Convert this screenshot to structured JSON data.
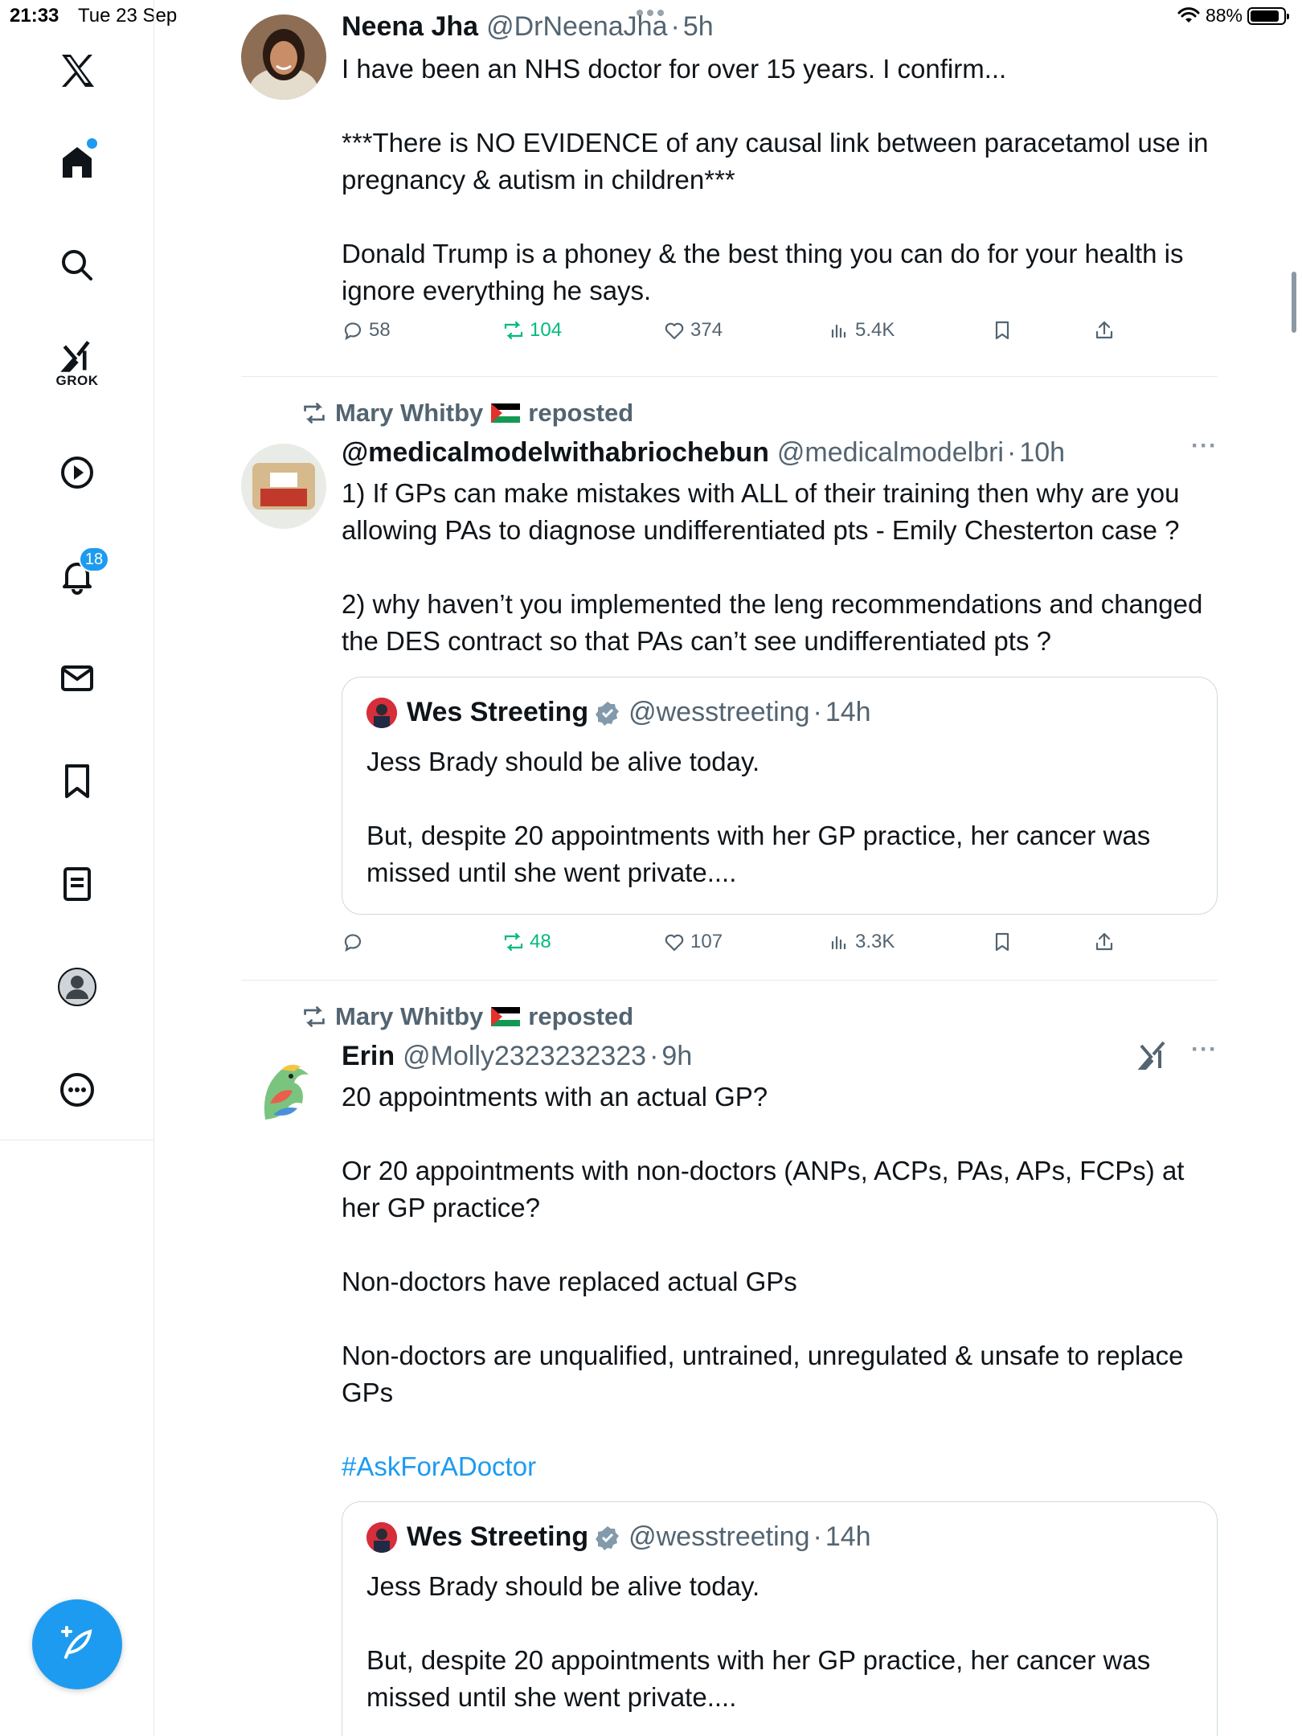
{
  "status_bar": {
    "time": "21:33",
    "date": "Tue 23 Sep",
    "battery": "88%",
    "battery_level": 0.88
  },
  "sidebar": {
    "grok_label": "GROK",
    "notifications_badge": "18"
  },
  "tweets": [
    {
      "name": "Neena Jha",
      "handle": "@DrNeenaJha",
      "sep": "·",
      "time": "5h",
      "paragraphs": [
        "I have been an NHS doctor for over 15 years. I confirm...",
        "***There is NO EVIDENCE of any causal link between paracetamol use in pregnancy & autism in children***",
        "Donald Trump is a phoney & the best thing you can do for your health is ignore everything he says."
      ],
      "stats": {
        "replies": "58",
        "reposts": "104",
        "likes": "374",
        "views": "5.4K"
      }
    },
    {
      "repost_by": "Mary Whitby",
      "repost_label": "reposted",
      "name": "@medicalmodelwithabriochebun",
      "handle": "@medicalmodelbri",
      "sep": "·",
      "time": "10h",
      "more": "···",
      "paragraphs": [
        "1) If GPs can make mistakes with ALL of their training then why are you allowing PAs to diagnose undifferentiated pts - Emily Chesterton case ?",
        "2) why haven’t you implemented the leng recommendations and changed the DES contract so that PAs can’t see undifferentiated pts ?"
      ],
      "quote": {
        "name": "Wes Streeting",
        "handle": "@wesstreeting",
        "sep": "·",
        "time": "14h",
        "paragraphs": [
          "Jess Brady should be alive today.",
          "But, despite 20 appointments with her GP practice, her cancer was missed until she went private...."
        ]
      },
      "stats": {
        "replies": "",
        "reposts": "48",
        "likes": "107",
        "views": "3.3K"
      }
    },
    {
      "repost_by": "Mary Whitby",
      "repost_label": "reposted",
      "name": "Erin",
      "handle": "@Molly2323232323",
      "sep": "·",
      "time": "9h",
      "more": "···",
      "paragraphs": [
        "20 appointments with an actual GP?",
        "Or 20 appointments with non-doctors (ANPs, ACPs, PAs, APs, FCPs) at her GP practice?",
        "Non-doctors have replaced actual GPs",
        "Non-doctors are unqualified, untrained, unregulated & unsafe to replace GPs"
      ],
      "hashtag": "#AskForADoctor",
      "quote": {
        "name": "Wes Streeting",
        "handle": "@wesstreeting",
        "sep": "·",
        "time": "14h",
        "paragraphs": [
          "Jess Brady should be alive today.",
          "But, despite 20 appointments with her GP practice, her cancer was missed until she went private...."
        ]
      }
    }
  ],
  "colors": {
    "accent": "#1d9bf0",
    "repost_green": "#00ba7c",
    "muted": "#536471"
  }
}
